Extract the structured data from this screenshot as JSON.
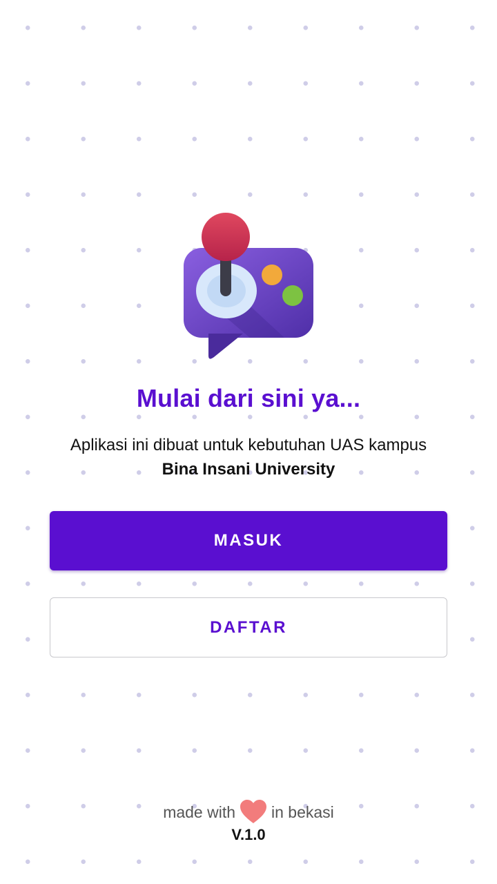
{
  "welcome": {
    "headline": "Mulai dari sini ya...",
    "description_line1": "Aplikasi ini dibuat untuk kebutuhan UAS kampus",
    "description_line2": "Bina Insani University",
    "logo_icon": "game-joystick-chat-icon"
  },
  "actions": {
    "login_label": "MASUK",
    "register_label": "DAFTAR"
  },
  "footer": {
    "made_with": "made with",
    "heart_icon": "heart-icon",
    "location": "in bekasi",
    "version": "V.1.0"
  },
  "colors": {
    "primary": "#5a0fd0",
    "heart": "#f27c7c",
    "logo_purple": "#6b45c6",
    "joystick_ball": "#d63a5a"
  }
}
